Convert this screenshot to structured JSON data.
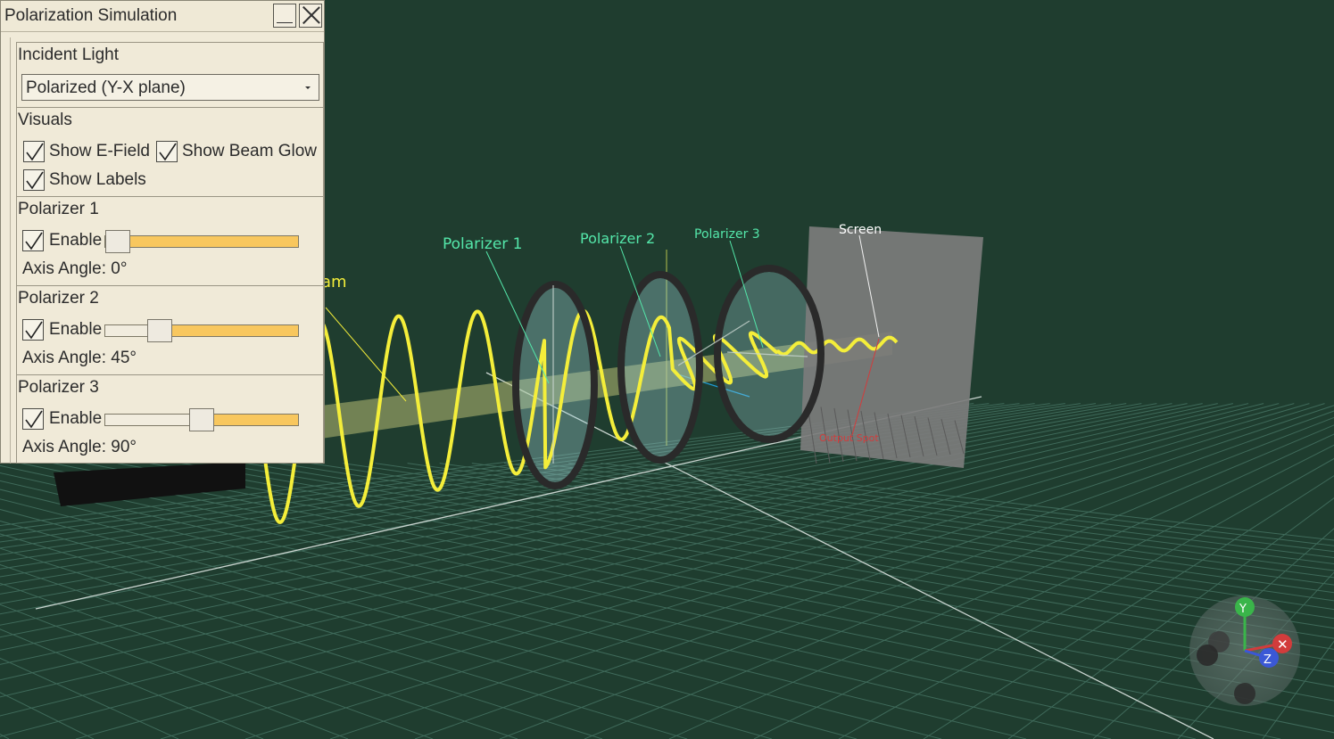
{
  "window": {
    "title": "Polarization Simulation"
  },
  "panel": {
    "incident": {
      "title": "Incident Light",
      "selected": "Polarized (Y-X plane)"
    },
    "visuals": {
      "title": "Visuals",
      "show_efield": {
        "label": "Show E-Field",
        "checked": true
      },
      "show_beam_glow": {
        "label": "Show Beam Glow",
        "checked": true
      },
      "show_labels": {
        "label": "Show Labels",
        "checked": true
      }
    },
    "polarizers": [
      {
        "title": "Polarizer 1",
        "enable_label": "Enable",
        "enabled": true,
        "angle_text": "Axis Angle: 0°",
        "slider_fraction": 0.0
      },
      {
        "title": "Polarizer 2",
        "enable_label": "Enable",
        "enabled": true,
        "angle_text": "Axis Angle: 45°",
        "slider_fraction": 0.25
      },
      {
        "title": "Polarizer 3",
        "enable_label": "Enable",
        "enabled": true,
        "angle_text": "Axis Angle: 90°",
        "slider_fraction": 0.5
      }
    ]
  },
  "scene": {
    "labels": {
      "beam_partial": "am",
      "polarizer1": "Polarizer 1",
      "polarizer2": "Polarizer 2",
      "polarizer3": "Polarizer 3",
      "screen": "Screen",
      "output_spot": "Output Spot"
    },
    "gizmo": {
      "y": "Y",
      "z": "Z"
    },
    "colors": {
      "background": "#1f3d2f",
      "wave": "#f4ee3a",
      "label_green": "#54e7aa",
      "ring": "#2a2a2a",
      "screen": "#7c7c7c"
    }
  }
}
